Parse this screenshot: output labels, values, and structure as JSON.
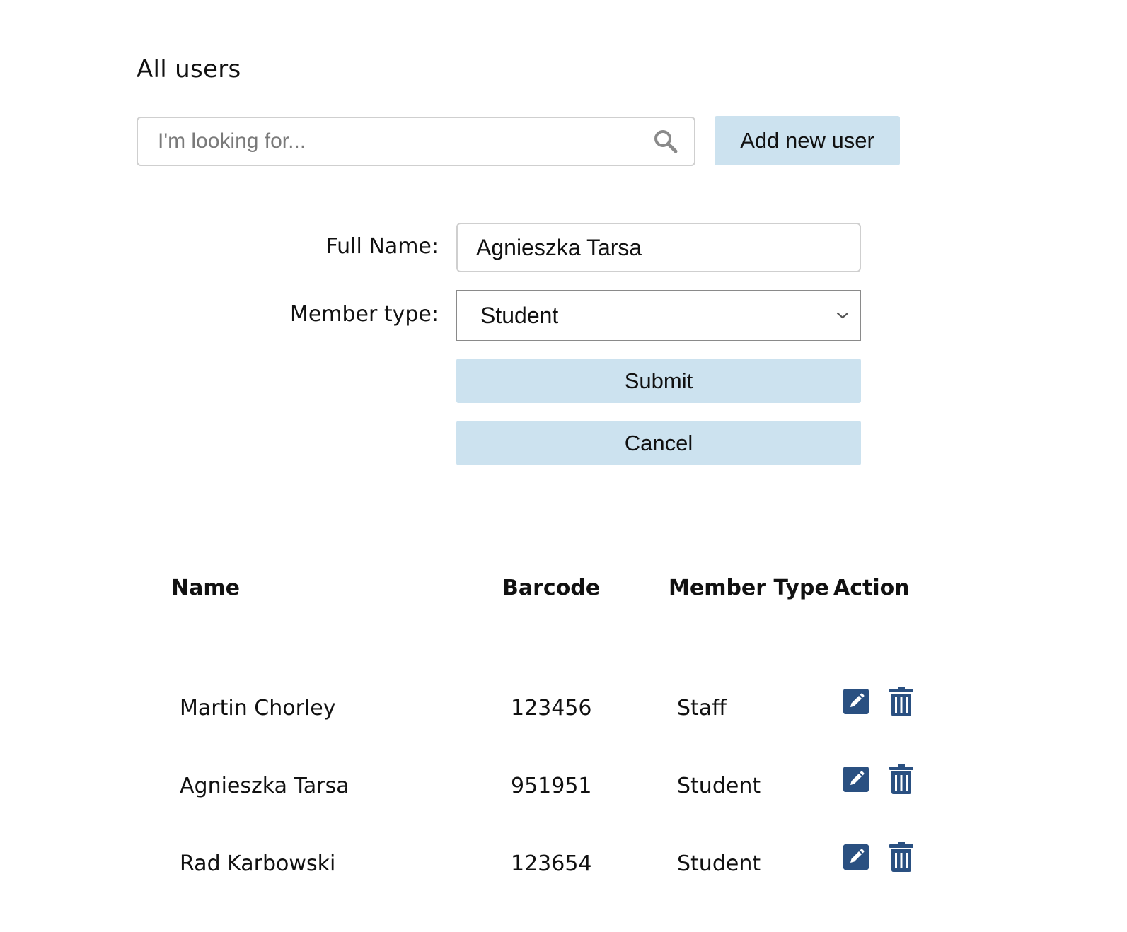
{
  "page": {
    "title": "All users"
  },
  "search": {
    "placeholder": "I'm looking for...",
    "value": "",
    "icon": "search-icon"
  },
  "toolbar": {
    "add_user_label": "Add new user"
  },
  "form": {
    "full_name_label": "Full Name:",
    "full_name_value": "Agnieszka Tarsa",
    "member_type_label": "Member type:",
    "member_type_value": "Student",
    "submit_label": "Submit",
    "cancel_label": "Cancel"
  },
  "table": {
    "headers": {
      "name": "Name",
      "barcode": "Barcode",
      "member_type": "Member Type",
      "action": "Action"
    },
    "rows": [
      {
        "name": "Martin Chorley",
        "barcode": "123456",
        "member_type": "Staff"
      },
      {
        "name": "Agnieszka Tarsa",
        "barcode": "951951",
        "member_type": "Student"
      },
      {
        "name": "Rad Karbowski",
        "barcode": "123654",
        "member_type": "Student"
      }
    ]
  },
  "colors": {
    "button_bg": "#cce2ef",
    "icon_color": "#2a5081"
  }
}
